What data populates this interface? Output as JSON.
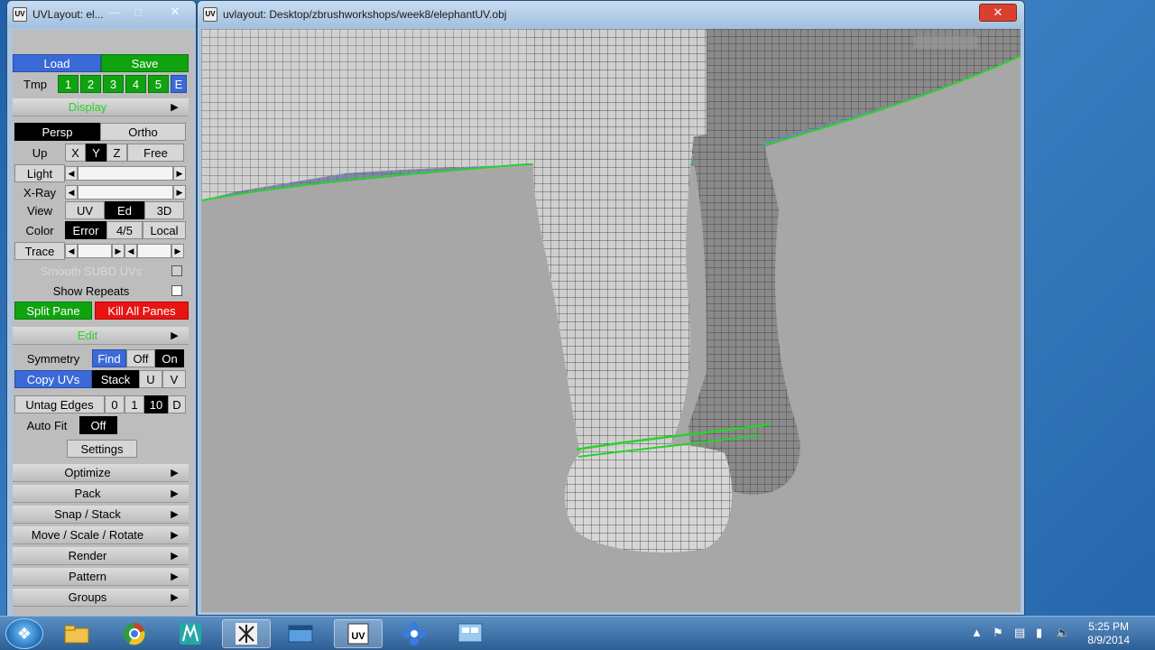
{
  "left_window": {
    "title": "UVLayout: el...",
    "icon_text": "UV",
    "load": "Load",
    "save": "Save",
    "tmp": "Tmp",
    "tmp_buttons": [
      "1",
      "2",
      "3",
      "4",
      "5",
      "E"
    ],
    "display_header": "Display",
    "persp": "Persp",
    "ortho": "Ortho",
    "up_label": "Up",
    "up_axes": [
      "X",
      "Y",
      "Z",
      "Free"
    ],
    "light": "Light",
    "xray": "X-Ray",
    "view_label": "View",
    "view_modes": [
      "UV",
      "Ed",
      "3D"
    ],
    "color_label": "Color",
    "color_modes": [
      "Error",
      "4/5",
      "Local"
    ],
    "trace": "Trace",
    "smooth_subd": "Smooth SUBD UVs",
    "show_repeats": "Show Repeats",
    "split_pane": "Split Pane",
    "kill_panes": "Kill All Panes",
    "edit_header": "Edit",
    "symmetry": "Symmetry",
    "find": "Find",
    "off": "Off",
    "on": "On",
    "copy_uvs": "Copy UVs",
    "stack": "Stack",
    "u": "U",
    "v": "V",
    "untag_edges": "Untag Edges",
    "untag_vals": [
      "0",
      "1",
      "10",
      "D"
    ],
    "auto_fit": "Auto Fit",
    "auto_fit_val": "Off",
    "settings": "Settings",
    "menus": [
      "Optimize",
      "Pack",
      "Snap / Stack",
      "Move / Scale / Rotate",
      "Render",
      "Pattern",
      "Groups"
    ]
  },
  "viewport_window": {
    "title": "uvlayout: Desktop/zbrushworkshops/week8/elephantUV.obj",
    "icon_text": "UV"
  },
  "taskbar": {
    "time": "5:25 PM",
    "date": "8/9/2014",
    "apps": [
      "explorer-icon",
      "chrome-icon",
      "maya-icon",
      "zbrush-icon",
      "window-icon",
      "uvlayout-icon",
      "flower-icon",
      "app-icon"
    ]
  },
  "colors": {
    "green": "#0fa30f",
    "red": "#e81414",
    "blue": "#3a69d8",
    "wire_green": "#2bd12b"
  }
}
